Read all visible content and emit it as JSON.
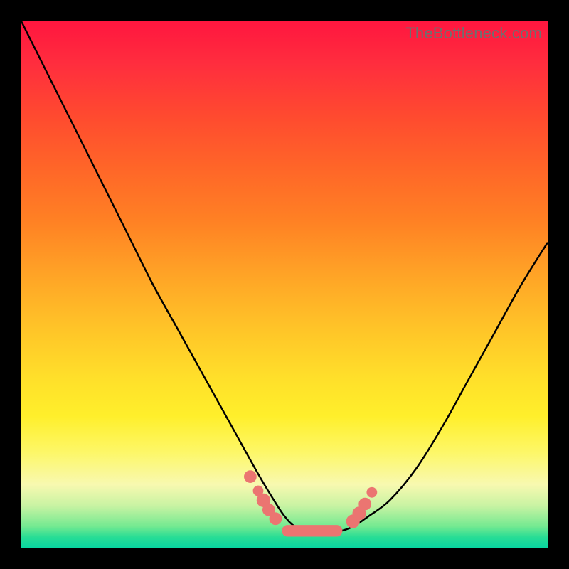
{
  "watermark": "TheBottleneck.com",
  "colors": {
    "marker": "#eb7571",
    "curve": "#000000"
  },
  "chart_data": {
    "type": "line",
    "title": "",
    "xlabel": "",
    "ylabel": "",
    "xlim": [
      0,
      100
    ],
    "ylim": [
      0,
      100
    ],
    "curve": {
      "comment": "U-shaped bottleneck curve; y=0 is bottom (green), y=100 is top (red). x is relative horizontal position in the plot.",
      "x": [
        0,
        5,
        10,
        15,
        20,
        25,
        30,
        35,
        40,
        45,
        48,
        50,
        52,
        55,
        58,
        60,
        63,
        66,
        70,
        75,
        80,
        85,
        90,
        95,
        100
      ],
      "y": [
        100,
        90,
        80,
        70,
        60,
        50,
        41,
        32,
        23,
        14,
        9,
        6,
        4,
        3,
        3,
        3,
        4,
        6,
        9,
        15,
        23,
        32,
        41,
        50,
        58
      ]
    },
    "markers": {
      "comment": "salmon/pink dots near the valley bottom and a flat oblong at the minimum",
      "points": [
        {
          "x": 43.5,
          "y": 13.5,
          "r": 1.2
        },
        {
          "x": 45.0,
          "y": 10.8,
          "r": 1.0
        },
        {
          "x": 46.0,
          "y": 9.0,
          "r": 1.3
        },
        {
          "x": 47.0,
          "y": 7.2,
          "r": 1.2
        },
        {
          "x": 48.3,
          "y": 5.5,
          "r": 1.2
        },
        {
          "x": 63.0,
          "y": 5.0,
          "r": 1.3
        },
        {
          "x": 64.2,
          "y": 6.5,
          "r": 1.3
        },
        {
          "x": 65.3,
          "y": 8.3,
          "r": 1.2
        },
        {
          "x": 66.6,
          "y": 10.5,
          "r": 1.0
        }
      ],
      "flat": {
        "x0": 49.5,
        "x1": 61.0,
        "y": 3.2,
        "h": 2.2
      }
    }
  }
}
